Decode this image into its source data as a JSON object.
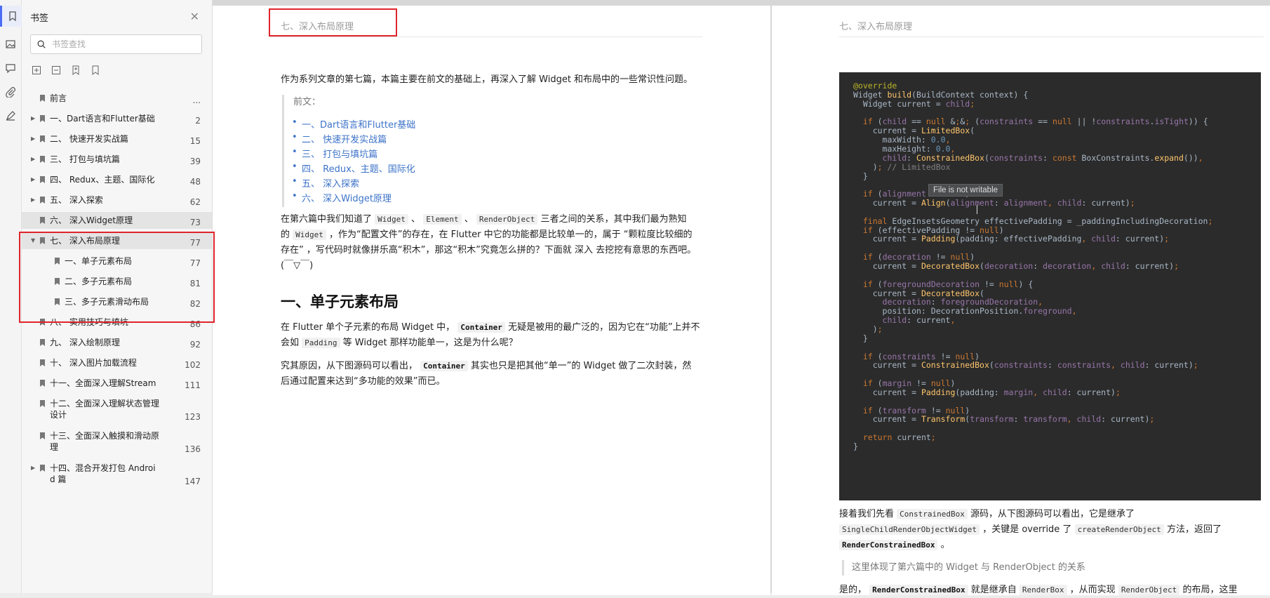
{
  "sidebar": {
    "title": "书签",
    "search_placeholder": "书签查找",
    "rail_icons": [
      "bookmark-icon",
      "image-icon",
      "comment-icon",
      "attachment-icon",
      "signature-icon"
    ],
    "tool_icons": [
      "expand-all-icon",
      "collapse-all-icon",
      "add-bookmark-icon",
      "bookmark-outline-icon"
    ],
    "items": [
      {
        "label": "前言",
        "page": "...",
        "expandable": false
      },
      {
        "label": "一、Dart语言和Flutter基础",
        "page": "2",
        "expandable": true
      },
      {
        "label": "二、 快速开发实战篇",
        "page": "15",
        "expandable": true
      },
      {
        "label": "三、 打包与填坑篇",
        "page": "39",
        "expandable": true
      },
      {
        "label": "四、 Redux、主题、国际化",
        "page": "48",
        "expandable": true
      },
      {
        "label": "五、 深入探索",
        "page": "62",
        "expandable": true
      },
      {
        "label": "六、 深入Widget原理",
        "page": "73",
        "expandable": false
      },
      {
        "label": "七、 深入布局原理",
        "page": "77",
        "expandable": true
      },
      {
        "label": "一、单子元素布局",
        "page": "77",
        "expandable": false
      },
      {
        "label": "二、多子元素布局",
        "page": "81",
        "expandable": false
      },
      {
        "label": "三、多子元素滑动布局",
        "page": "82",
        "expandable": false
      },
      {
        "label": "八、 实用技巧与填坑",
        "page": "86",
        "expandable": false
      },
      {
        "label": "九、 深入绘制原理",
        "page": "92",
        "expandable": false
      },
      {
        "label": "十、 深入图片加载流程",
        "page": "102",
        "expandable": false
      },
      {
        "label": "十一、全面深入理解Stream",
        "page": "111",
        "expandable": false
      },
      {
        "label": "十二、全面深入理解状态管理",
        "label2": "设计",
        "page": "123",
        "expandable": false
      },
      {
        "label": "十三、全面深入触摸和滑动原",
        "label2": "理",
        "page": "136",
        "expandable": false
      },
      {
        "label": "十四、混合开发打包 Androi",
        "label2": "d 篇",
        "page": "147",
        "expandable": true
      }
    ]
  },
  "page1": {
    "header": "七、深入布局原理",
    "intro": "作为系列文章的第七篇，本篇主要在前文的基础上，再深入了解 Widget 和布局中的一些常识性问题。",
    "quote_label": "前文：",
    "links": [
      "一、Dart语言和Flutter基础",
      "二、 快速开发实战篇",
      "三、 打包与填坑篇",
      "四、 Redux、主题、国际化",
      "五、 深入探索",
      "六、 深入Widget原理"
    ],
    "para1": {
      "a": "在第六篇中我们知道了",
      "c1": "Widget",
      "s1": "、",
      "c2": "Element",
      "s2": "、",
      "c3": "RenderObject",
      "b": "三者之间的关系，其中我们最为熟知",
      "d": "的",
      "c4": "Widget",
      "e": "，作为“配置文件”的存在，在 Flutter 中它的功能都是比较单一的，属于 “颗粒度比较细的",
      "f": "存在” ，写代码时就像拼乐高“积木”，那这“积木”究竟怎么拼的？下面就 深入 去挖挖有意思的东西吧。",
      "g": "(￣▽￣)"
    },
    "h2": "一、单子元素布局",
    "para2": {
      "a": "在 Flutter 单个子元素的布局 Widget 中，",
      "c1": "Container",
      "b": "无疑是被用的最广泛的，因为它在“功能”上并不",
      "c": "会如",
      "c2": "Padding",
      "d": "等 Widget 那样功能单一，这是为什么呢？"
    },
    "para3": {
      "a": "究其原因，从下图源码可以看出，",
      "c1": "Container",
      "b": "其实也只是把其他“单一”的 Widget 做了二次封装，然",
      "c": "后通过配置来达到“多功能的效果”而已。"
    }
  },
  "page2": {
    "header": "七、深入布局原理",
    "code_lines": [
      "@override",
      "Widget build(BuildContext context) {",
      "  Widget current = child;",
      "",
      "  if (child == null && (constraints == null || !constraints.isTight)) {",
      "    current = LimitedBox(",
      "      maxWidth: 0.0,",
      "      maxHeight: 0.0,",
      "      child: ConstrainedBox(constraints: const BoxConstraints.expand()),",
      "    ); // LimitedBox",
      "  }",
      "",
      "  if (alignment != null)",
      "    current = Align(alignment: alignment, child: current);",
      "",
      "  final EdgeInsetsGeometry effectivePadding = _paddingIncludingDecoration;",
      "  if (effectivePadding != null)",
      "    current = Padding(padding: effectivePadding, child: current);",
      "",
      "  if (decoration != null)",
      "    current = DecoratedBox(decoration: decoration, child: current);",
      "",
      "  if (foregroundDecoration != null) {",
      "    current = DecoratedBox(",
      "      decoration: foregroundDecoration,",
      "      position: DecorationPosition.foreground,",
      "      child: current,",
      "    );",
      "  }",
      "",
      "  if (constraints != null)",
      "    current = ConstrainedBox(constraints: constraints, child: current);",
      "",
      "  if (margin != null)",
      "    current = Padding(padding: margin, child: current);",
      "",
      "  if (transform != null)",
      "    current = Transform(transform: transform, child: current);",
      "",
      "  return current;",
      "}"
    ],
    "tooltip": "File is not writable",
    "para1": {
      "a": "接着我们先看",
      "c1": "ConstrainedBox",
      "b": "源码，从下图源码可以看出，它是继承了",
      "c2": "SingleChildRenderObjectWidget",
      "c": "，关键是 override 了",
      "c3": "createRenderObject",
      "d": "方法，返回了",
      "c4": "RenderConstrainedBox",
      "e": "。"
    },
    "quote": "这里体现了第六篇中的 Widget 与 RenderObject 的关系",
    "para2": {
      "a": "是的，",
      "c1": "RenderConstrainedBox",
      "b": "就是继承自",
      "c2": "RenderBox",
      "c": "，从而实现",
      "c3": "RenderObject",
      "d": "的布局，这里"
    }
  }
}
